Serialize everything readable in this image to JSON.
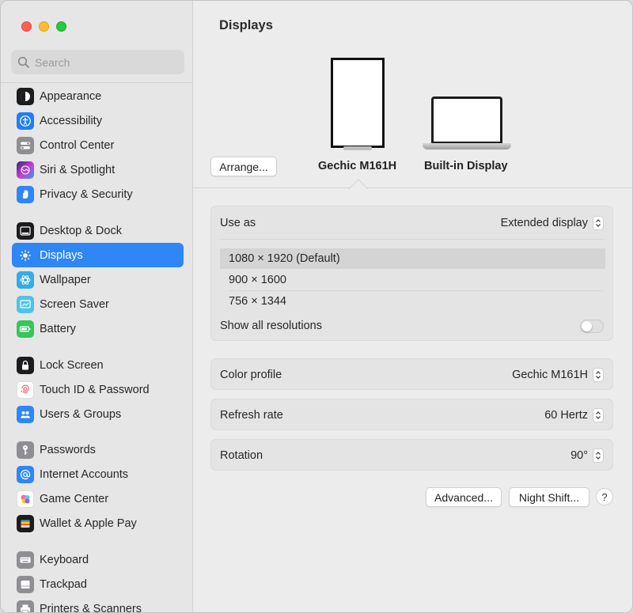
{
  "window": {
    "title": "Displays"
  },
  "search": {
    "placeholder": "Search"
  },
  "sidebar": {
    "items": [
      {
        "label": "Appearance",
        "icon": "appearance-icon",
        "color": "#1c1c1e"
      },
      {
        "label": "Accessibility",
        "icon": "accessibility-icon",
        "color": "#1f7ef2"
      },
      {
        "label": "Control Center",
        "icon": "control-center-icon",
        "color": "#8e8e93"
      },
      {
        "label": "Siri & Spotlight",
        "icon": "siri-icon",
        "color": "#6a3fd4"
      },
      {
        "label": "Privacy & Security",
        "icon": "hand-icon",
        "color": "#2f86f5"
      },
      {
        "label": "Desktop & Dock",
        "icon": "dock-icon",
        "color": "#1c1c1e"
      },
      {
        "label": "Displays",
        "icon": "sun-icon",
        "color": "#2f86f5",
        "active": true
      },
      {
        "label": "Wallpaper",
        "icon": "wallpaper-icon",
        "color": "#32ade6"
      },
      {
        "label": "Screen Saver",
        "icon": "screen-saver-icon",
        "color": "#4fc3e8"
      },
      {
        "label": "Battery",
        "icon": "battery-icon",
        "color": "#34c759"
      },
      {
        "label": "Lock Screen",
        "icon": "lock-icon",
        "color": "#1c1c1e"
      },
      {
        "label": "Touch ID & Password",
        "icon": "fingerprint-icon",
        "color": "#ffffff"
      },
      {
        "label": "Users & Groups",
        "icon": "users-icon",
        "color": "#2f86f5"
      },
      {
        "label": "Passwords",
        "icon": "key-icon",
        "color": "#8e8e93"
      },
      {
        "label": "Internet Accounts",
        "icon": "at-icon",
        "color": "#2f86f5"
      },
      {
        "label": "Game Center",
        "icon": "game-center-icon",
        "color": "#ffffff"
      },
      {
        "label": "Wallet & Apple Pay",
        "icon": "wallet-icon",
        "color": "#1c1c1e"
      },
      {
        "label": "Keyboard",
        "icon": "keyboard-icon",
        "color": "#8e8e93"
      },
      {
        "label": "Trackpad",
        "icon": "trackpad-icon",
        "color": "#8e8e93"
      },
      {
        "label": "Printers & Scanners",
        "icon": "printer-icon",
        "color": "#8e8e93"
      }
    ]
  },
  "displays": {
    "arrange_label": "Arrange...",
    "external_name": "Gechic M161H",
    "builtin_name": "Built-in Display"
  },
  "settings": {
    "use_as_label": "Use as",
    "use_as_value": "Extended display",
    "resolutions": [
      "1080 × 1920 (Default)",
      "900 × 1600",
      "756 × 1344"
    ],
    "selected_resolution": "1080 × 1920 (Default)",
    "show_all_label": "Show all resolutions",
    "show_all_on": false,
    "color_profile_label": "Color profile",
    "color_profile_value": "Gechic M161H",
    "refresh_rate_label": "Refresh rate",
    "refresh_rate_value": "60 Hertz",
    "rotation_label": "Rotation",
    "rotation_value": "90°"
  },
  "footer": {
    "advanced_label": "Advanced...",
    "night_shift_label": "Night Shift...",
    "help_label": "?"
  }
}
